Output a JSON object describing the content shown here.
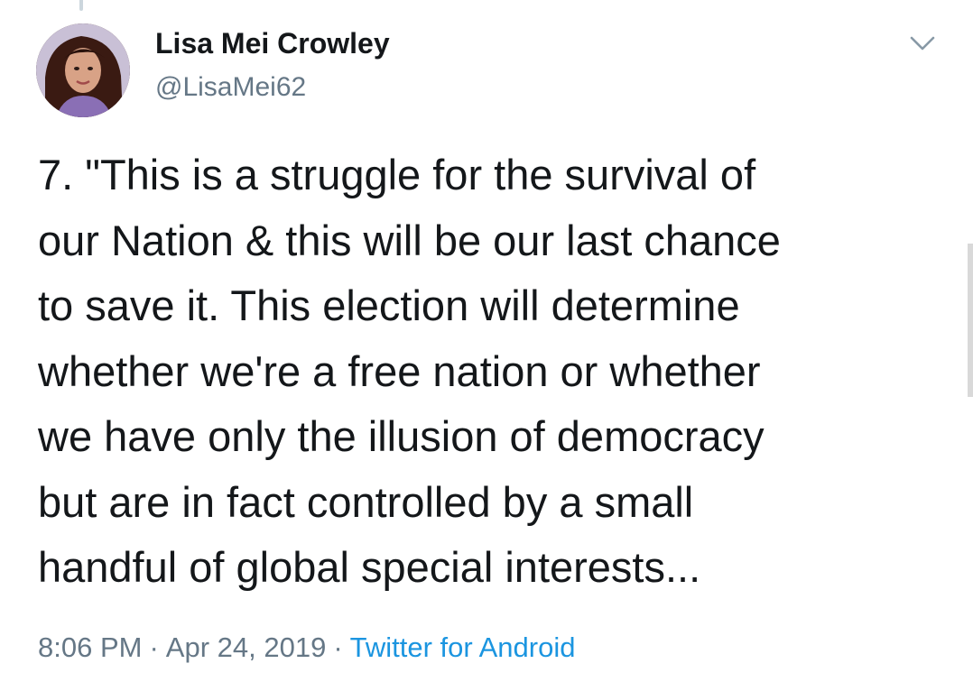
{
  "tweet": {
    "author": {
      "display_name": "Lisa Mei Crowley",
      "handle": "@LisaMei62"
    },
    "text": "7. \"This is a struggle for the survival of\nour Nation & this will be our last chance\nto save it. This election will determine\nwhether we're a free nation or whether\nwe have only the illusion of democracy\nbut are in fact controlled by a small\nhandful of global special interests...",
    "time": "8:06 PM",
    "separator": "·",
    "date": "Apr 24, 2019",
    "source": "Twitter for Android",
    "menu_icon": "chevron-down-icon"
  },
  "colors": {
    "text": "#14171a",
    "secondary": "#657786",
    "link": "#1b95e0"
  }
}
